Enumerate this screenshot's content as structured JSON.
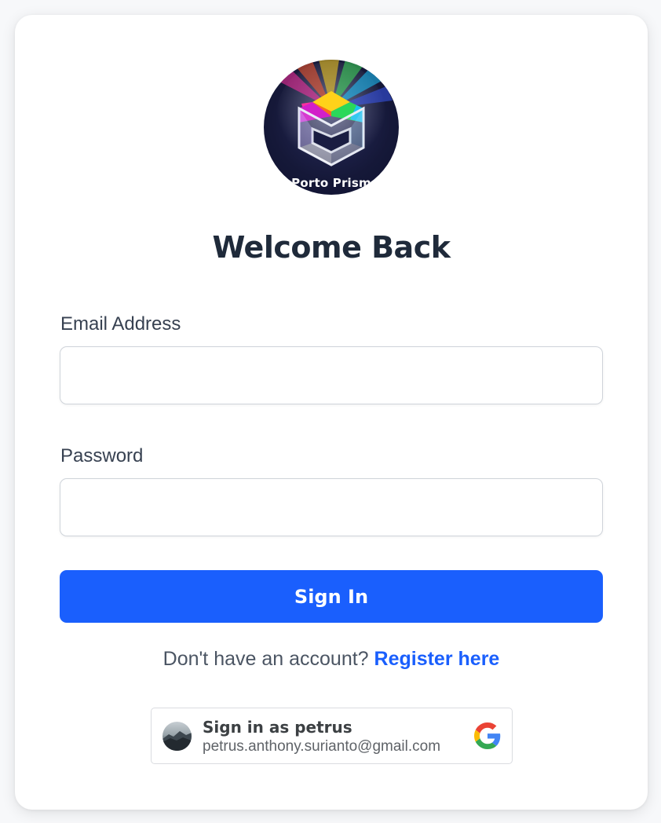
{
  "logo": {
    "text": "Porto Prism"
  },
  "form": {
    "title": "Welcome Back",
    "email_label": "Email Address",
    "email_value": "",
    "password_label": "Password",
    "password_value": "",
    "signin_label": "Sign In"
  },
  "register": {
    "prompt": "Don't have an account?",
    "link": "Register here"
  },
  "google": {
    "name_line": "Sign in as petrus",
    "email": "petrus.anthony.surianto@gmail.com",
    "icon": "google-logo-icon"
  },
  "colors": {
    "primary": "#1a5ffd",
    "title": "#1f2a3a",
    "background": "#f7f8fa"
  }
}
